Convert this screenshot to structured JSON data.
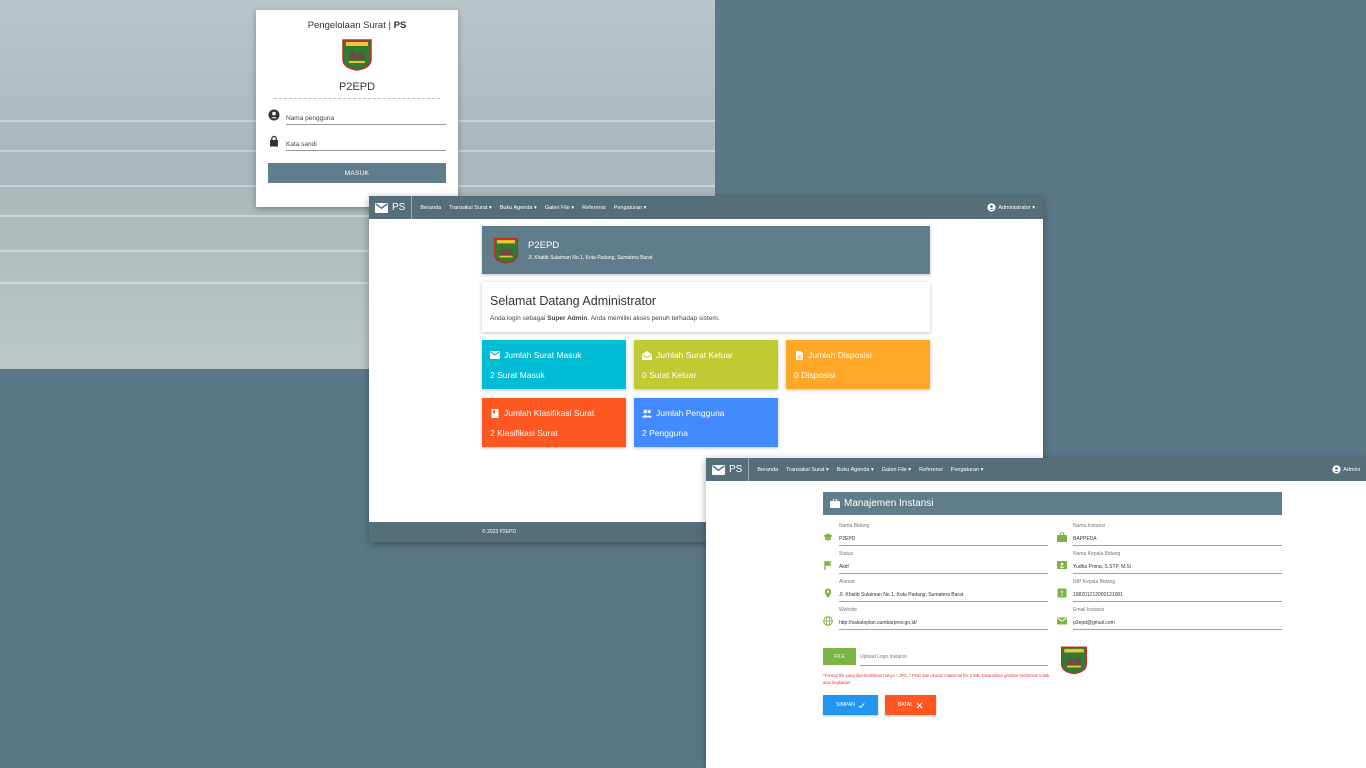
{
  "login": {
    "title_prefix": "Pengelolaan Surat | ",
    "title_bold": "PS",
    "brand": "P2EPD",
    "username_placeholder": "Nama pengguna",
    "password_placeholder": "Kata sandi",
    "submit_label": "MASUK"
  },
  "navbar": {
    "brand": "PS",
    "items": [
      "Beranda",
      "Transaksi Surat ▾",
      "Buku Agenda ▾",
      "Galeri File ▾",
      "Referensi",
      "Pengaturan ▾"
    ],
    "user": "Administrator ▾",
    "user_cut": "Admini"
  },
  "dashboard": {
    "institution_name": "P2EPD",
    "institution_address": "Jl. Khatib Sulaiman No.1, Kota Padang, Sumatera Barat",
    "welcome_title": "Selamat Datang Administrator",
    "welcome_pre": "Anda login sebagai ",
    "welcome_role": "Super Admin",
    "welcome_post": ". Anda memiliki akses penuh terhadap sistem.",
    "tiles": [
      {
        "label": "Jumlah Surat Masuk",
        "value": "2 Surat Masuk",
        "color": "#00bcd4",
        "icon": "mail-icon"
      },
      {
        "label": "Jumlah Surat Keluar",
        "value": "0 Surat Keluar",
        "color": "#c0ca33",
        "icon": "drafts-icon"
      },
      {
        "label": "Jumlah Disposisi",
        "value": "0 Disposisi",
        "color": "#ffa726",
        "icon": "description-icon"
      },
      {
        "label": "Jumlah Klasifikasi Surat",
        "value": "2 Klasifikasi Surat",
        "color": "#ff5722",
        "icon": "book-icon"
      },
      {
        "label": "Jumlah Pengguna",
        "value": "2 Pengguna",
        "color": "#448aff",
        "icon": "people-icon"
      }
    ],
    "footer": "© 2023 P2EPD"
  },
  "instansi": {
    "title": "Manajemen Instansi",
    "fields": {
      "nama_bidang": {
        "label": "Nama Bidang",
        "value": "P2EPD"
      },
      "status": {
        "label": "Status",
        "value": "Aktif"
      },
      "alamat": {
        "label": "Alamat",
        "value": "Jl. Khatib Sulaiman No.1, Kota Padang, Sumatera Barat"
      },
      "website": {
        "label": "Website",
        "value": "http://sakatoplan.sumbarprov.go.id/"
      },
      "nama_instansi": {
        "label": "Nama Instansi",
        "value": "BAPPEDA"
      },
      "kepala_bidang": {
        "label": "Nama Kepala Bidang",
        "value": "Yudha Prima, S.STP, M.Si"
      },
      "nip": {
        "label": "NIP Kepala Bidang",
        "value": "198201212000121001"
      },
      "email": {
        "label": "Email Instansi",
        "value": "p2epd@gmail.com"
      }
    },
    "file_button": "FILE",
    "file_placeholder": "Upload Logo instansi",
    "file_note": "*Format file yang diperbolehkan hanya *.JPG, *.PNG dan ukuran maksimal file 2 MB. Disarankan gambar berbentuk kotak atau lingkaran!",
    "save_label": "SIMPAN",
    "cancel_label": "BATAL"
  },
  "colors": {
    "navbar": "#546e7a",
    "header": "#607d8b",
    "page_bg": "#5b7888",
    "file_button": "#7cb342",
    "save_button": "#2196f3",
    "cancel_button": "#ff5722"
  }
}
